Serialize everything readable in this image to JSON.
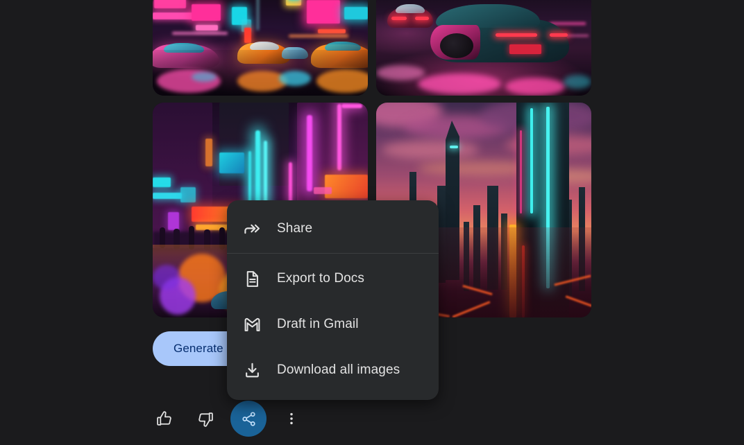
{
  "theme": {
    "page_background": "#1b1b1d",
    "menu_background": "#282a2c",
    "menu_text": "#e3e3e3",
    "divider": "#3c3e40",
    "accent_button_bg": "#a8c7fa",
    "accent_button_text": "#062e6f",
    "active_action_bg": "#1a6398",
    "icon_color": "#e3e3e3"
  },
  "results": {
    "images": [
      {
        "id": "image-1",
        "alt": "Neon-lit cyberpunk city street at night with four glowing sports cars racing on wet asphalt",
        "position": "top-left",
        "size": "wide"
      },
      {
        "id": "image-2",
        "alt": "Rear view of a teal and magenta supercar with glowing red tail lights on a rain-slicked neon street",
        "position": "top-right",
        "size": "wide"
      },
      {
        "id": "image-3",
        "alt": "Ground-level cyberpunk alley crowded with people, towering neon signs and reflections on wet pavement",
        "position": "bottom-left",
        "size": "tall"
      },
      {
        "id": "image-4",
        "alt": "Futuristic megacity skyline at sunset with pink and purple clouds, dark spires and glowing orange streets",
        "position": "bottom-right",
        "size": "tall"
      }
    ]
  },
  "generate": {
    "label": "Generate more"
  },
  "action_bar": {
    "buttons": [
      {
        "name": "thumb-up",
        "icon": "thumb-up-icon",
        "label": "Good response",
        "active": false
      },
      {
        "name": "thumb-down",
        "icon": "thumb-down-icon",
        "label": "Bad response",
        "active": false
      },
      {
        "name": "share",
        "icon": "share-nodes-icon",
        "label": "Share & export",
        "active": true
      },
      {
        "name": "more",
        "icon": "more-vert-icon",
        "label": "More",
        "active": false
      }
    ]
  },
  "share_menu": {
    "open": true,
    "items": [
      {
        "label": "Share",
        "icon": "share-arrow-icon"
      },
      {
        "label": "Export to Docs",
        "icon": "document-icon"
      },
      {
        "label": "Draft in Gmail",
        "icon": "gmail-icon"
      },
      {
        "label": "Download all images",
        "icon": "download-icon"
      }
    ]
  }
}
